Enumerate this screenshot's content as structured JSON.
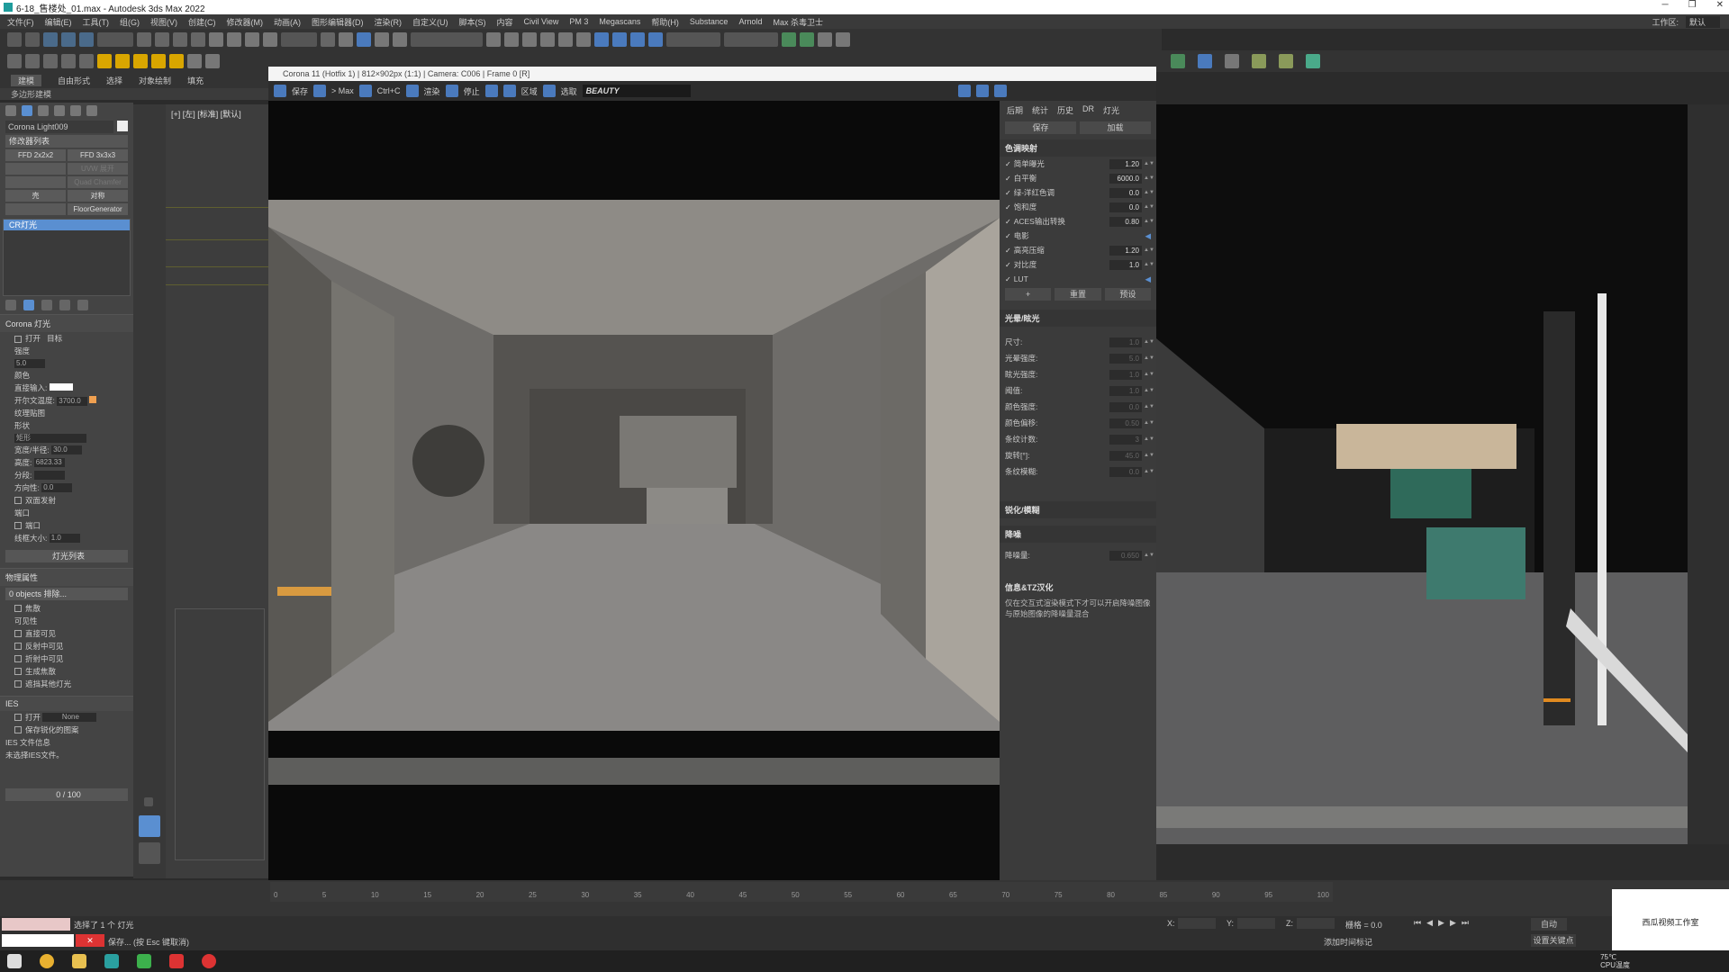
{
  "window": {
    "title": "6-18_售楼处_01.max - Autodesk 3ds Max 2022",
    "min": "─",
    "restore": "❐",
    "close": "✕"
  },
  "menu": {
    "items": [
      "文件(F)",
      "编辑(E)",
      "工具(T)",
      "组(G)",
      "视图(V)",
      "创建(C)",
      "修改器(M)",
      "动画(A)",
      "图形编辑器(D)",
      "渲染(R)",
      "自定义(U)",
      "脚本(S)",
      "内容",
      "Civil View",
      "PM 3",
      "Megascans",
      "帮助(H)",
      "Substance",
      "Arnold",
      "Max 杀毒卫士"
    ],
    "workspace_label": "工作区:",
    "workspace_value": "默认"
  },
  "ribbon": {
    "tabs": [
      "建模",
      "自由形式",
      "选择",
      "对象绘制",
      "填充"
    ],
    "sub": "多边形建模"
  },
  "command_panel": {
    "object_name": "Corona Light009",
    "modifier_list": "修改器列表",
    "buttons": [
      [
        "FFD 2x2x2",
        "FFD 3x3x3"
      ],
      [
        "",
        "UVW 展开"
      ],
      [
        "",
        "Quad Chamfer"
      ],
      [
        "壳",
        "对称"
      ],
      [
        "",
        "FloorGenerator"
      ]
    ],
    "stack_item": "CR灯光",
    "rollout_light": "Corona 灯光",
    "on_label": "打开",
    "target_label": "目标",
    "intensity_label": "强度",
    "intensity_value": "5.0",
    "color_label": "颜色",
    "direct_input": "直接输入:",
    "kelvin_label": "开尔文温度:",
    "kelvin_value": "3700.0",
    "texmap": "纹理贴图",
    "shape_label": "形状",
    "shape_value": "矩形",
    "width_label": "宽度/半径:",
    "width_value": "30.0",
    "height_label": "高度:",
    "height_value": "6823.33",
    "segments_label": "分段:",
    "directionality_label": "方向性:",
    "directionality_value": "0.0",
    "double_sided": "双面发射",
    "portal_label": "端口",
    "portal_check": "端口",
    "portal_size_label": "线框大小:",
    "portal_size_value": "1.0",
    "light_list_btn": "灯光列表",
    "rollout_include": "物理属性",
    "include_btn": "0 objects 排除...",
    "caustics": "焦散",
    "visibility_label": "可见性",
    "vis_items": [
      "直接可见",
      "反射中可见",
      "折射中可见",
      "生成焦散",
      "遮挡其他灯光"
    ],
    "rollout_ies": "IES",
    "ies_on": "打开",
    "ies_none": "None",
    "ies_keep": "保存锐化的图案",
    "ies_info": "IES 文件信息",
    "ies_none_loaded": "未选择IES文件。",
    "frame_counter": "0 / 100"
  },
  "left_viewport": {
    "label": "[+] [左] [标准] [默认]"
  },
  "corona": {
    "title": "Corona 11 (Hotfix 1) | 812×902px (1:1) | Camera: C006 | Frame 0 [R]",
    "toolbar": [
      "保存",
      "> Max",
      "Ctrl+C",
      "渲染",
      "停止",
      "区域",
      "选取"
    ],
    "channel": "BEAUTY",
    "settings_tabs": [
      "后期",
      "统计",
      "历史",
      "DR",
      "灯光"
    ],
    "settings_btns": [
      "保存",
      "加载"
    ],
    "tonemap_title": "色调映射",
    "tonemap": [
      {
        "name": "简单曝光",
        "value": "1.20"
      },
      {
        "name": "白平衡",
        "value": "6000.0"
      },
      {
        "name": "绿-洋红色调",
        "value": "0.0"
      },
      {
        "name": "饱和度",
        "value": "0.0"
      },
      {
        "name": "ACES输出转换",
        "value": "0.80"
      },
      {
        "name": "电影",
        "value": ""
      },
      {
        "name": "高亮压缩",
        "value": "1.20"
      },
      {
        "name": "对比度",
        "value": "1.0"
      },
      {
        "name": "LUT",
        "value": ""
      }
    ],
    "tonemap_btns": [
      "+",
      "重置",
      "预设"
    ],
    "bloom_title": "光晕/眩光",
    "bloom": [
      {
        "name": "尺寸:",
        "value": "1.0"
      },
      {
        "name": "光晕强度:",
        "value": "5.0"
      },
      {
        "name": "眩光强度:",
        "value": "1.0"
      },
      {
        "name": "阈值:",
        "value": "1.0"
      },
      {
        "name": "颜色强度:",
        "value": "0.0"
      },
      {
        "name": "颜色偏移:",
        "value": "0.50"
      },
      {
        "name": "条纹计数:",
        "value": "3"
      },
      {
        "name": "旋转[°]:",
        "value": "45.0"
      },
      {
        "name": "条纹模糊:",
        "value": "0.0"
      }
    ],
    "sharpen_title": "锐化/模糊",
    "denoise_title": "降噪",
    "denoise_label": "降噪量:",
    "denoise_value": "0.650",
    "info_title": "信息&TZ汉化",
    "info_text": "仅在交互式渲染模式下才可以开启降噪图像与原始图像的降噪量混合"
  },
  "timeline": {
    "ruler": [
      "0",
      "5",
      "10",
      "15",
      "20",
      "25",
      "30",
      "35",
      "40",
      "45",
      "50",
      "55",
      "60",
      "65",
      "70",
      "75",
      "80",
      "85",
      "90",
      "95",
      "100"
    ]
  },
  "status": {
    "selected": "选择了 1 个 灯光",
    "prompt": "保存... (按 Esc 键取消)",
    "x_label": "X:",
    "y_label": "Y:",
    "z_label": "Z:",
    "grid": "栅格 = 0.0",
    "auto": "自动",
    "set_key": "设置关键点",
    "add_time_tag": "添加时间标记"
  },
  "taskbar": {
    "time": "75℃\nCPU温度"
  },
  "watermark": {
    "text": "西瓜视频工作室"
  },
  "colors": {
    "accent": "#5a8fd1",
    "highlight": "#c8a000",
    "swatch_orange": "#f0a050"
  }
}
